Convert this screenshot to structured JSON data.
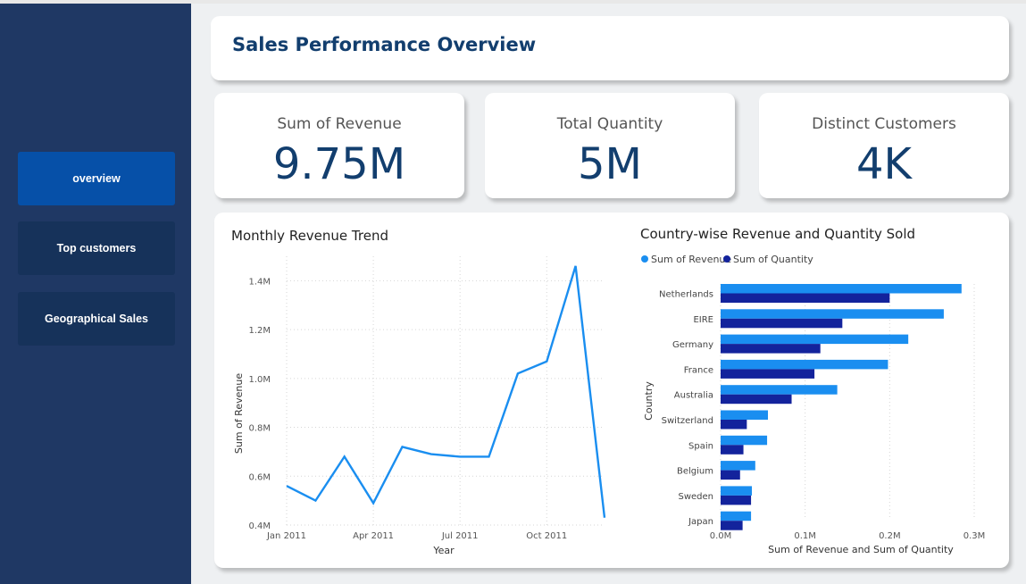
{
  "sidebar": {
    "items": [
      {
        "label": "overview",
        "active": true
      },
      {
        "label": "Top customers",
        "active": false
      },
      {
        "label": "Geographical Sales",
        "active": false
      }
    ]
  },
  "header": {
    "title": "Sales Performance Overview"
  },
  "kpis": [
    {
      "label": "Sum of Revenue",
      "value": "9.75M"
    },
    {
      "label": "Total Quantity",
      "value": "5M"
    },
    {
      "label": "Distinct Customers",
      "value": "4K"
    }
  ],
  "colors": {
    "accent": "#1f3864",
    "revenue": "#1a8ef0",
    "quantity": "#13239c",
    "title": "#123e6e"
  },
  "chart_data": [
    {
      "type": "line",
      "title": "Monthly Revenue Trend",
      "xlabel": "Year",
      "ylabel": "Sum of Revenue",
      "x_ticks": [
        "Jan 2011",
        "Apr 2011",
        "Jul 2011",
        "Oct 2011"
      ],
      "y_ticks": [
        "0.4M",
        "0.6M",
        "0.8M",
        "1.0M",
        "1.2M",
        "1.4M"
      ],
      "ylim": [
        0.4,
        1.5
      ],
      "grid": true,
      "series": [
        {
          "values": [
            0.56,
            0.5,
            0.68,
            0.49,
            0.72,
            0.69,
            0.68,
            0.68,
            1.02,
            1.07,
            1.46,
            0.43
          ]
        }
      ]
    },
    {
      "type": "bar",
      "orientation": "horizontal",
      "title": "Country-wise Revenue and Quantity Sold",
      "xlabel": "Sum of Revenue and Sum of Quantity",
      "ylabel": "Country",
      "x_ticks": [
        "0.0M",
        "0.1M",
        "0.2M",
        "0.3M"
      ],
      "xlim": [
        0,
        0.3
      ],
      "legend_position": "top-left",
      "categories": [
        "Netherlands",
        "EIRE",
        "Germany",
        "France",
        "Australia",
        "Switzerland",
        "Spain",
        "Belgium",
        "Sweden",
        "Japan"
      ],
      "series": [
        {
          "name": "Sum of Revenue",
          "values": [
            0.285,
            0.264,
            0.222,
            0.198,
            0.138,
            0.056,
            0.055,
            0.041,
            0.037,
            0.036
          ]
        },
        {
          "name": "Sum of Quantity",
          "values": [
            0.2,
            0.144,
            0.118,
            0.111,
            0.084,
            0.031,
            0.027,
            0.023,
            0.036,
            0.026
          ]
        }
      ]
    }
  ]
}
